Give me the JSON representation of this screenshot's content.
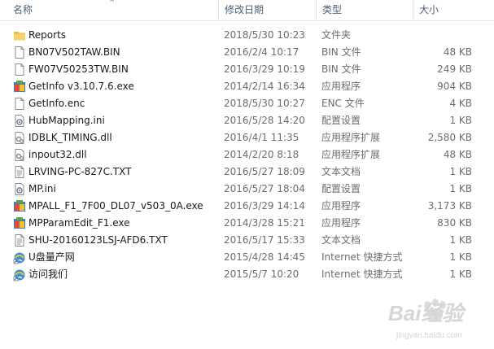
{
  "header": {
    "name": "名称",
    "date": "修改日期",
    "type": "类型",
    "size": "大小"
  },
  "files": [
    {
      "name": "Reports",
      "date": "2018/5/30 10:23",
      "type": "文件夹",
      "size": "",
      "icon": "folder-icon"
    },
    {
      "name": "BN07V502TAW.BIN",
      "date": "2016/2/4 10:17",
      "type": "BIN 文件",
      "size": "48 KB",
      "icon": "file-icon"
    },
    {
      "name": "FW07V50253TW.BIN",
      "date": "2016/3/29 10:19",
      "type": "BIN 文件",
      "size": "249 KB",
      "icon": "file-icon"
    },
    {
      "name": "GetInfo v3.10.7.6.exe",
      "date": "2014/2/14 16:34",
      "type": "应用程序",
      "size": "904 KB",
      "icon": "exe-icon"
    },
    {
      "name": "GetInfo.enc",
      "date": "2018/5/30 10:27",
      "type": "ENC 文件",
      "size": "4 KB",
      "icon": "file-icon"
    },
    {
      "name": "HubMapping.ini",
      "date": "2016/5/28 14:20",
      "type": "配置设置",
      "size": "1 KB",
      "icon": "ini-icon"
    },
    {
      "name": "IDBLK_TIMING.dll",
      "date": "2016/4/1 11:35",
      "type": "应用程序扩展",
      "size": "2,580 KB",
      "icon": "dll-icon"
    },
    {
      "name": "inpout32.dll",
      "date": "2014/2/20 8:18",
      "type": "应用程序扩展",
      "size": "48 KB",
      "icon": "dll-icon"
    },
    {
      "name": "LRVING-PC-827C.TXT",
      "date": "2016/5/27 18:09",
      "type": "文本文档",
      "size": "1 KB",
      "icon": "text-file-icon"
    },
    {
      "name": "MP.ini",
      "date": "2016/5/27 18:04",
      "type": "配置设置",
      "size": "1 KB",
      "icon": "ini-icon"
    },
    {
      "name": "MPALL_F1_7F00_DL07_v503_0A.exe",
      "date": "2016/3/29 14:14",
      "type": "应用程序",
      "size": "3,173 KB",
      "icon": "exe-icon"
    },
    {
      "name": "MPParamEdit_F1.exe",
      "date": "2014/3/28 15:21",
      "type": "应用程序",
      "size": "830 KB",
      "icon": "exe-icon"
    },
    {
      "name": "SHU-20160123LSJ-AFD6.TXT",
      "date": "2016/5/17 15:33",
      "type": "文本文档",
      "size": "1 KB",
      "icon": "text-file-icon"
    },
    {
      "name": "U盘量产网",
      "date": "2015/4/28 14:45",
      "type": "Internet 快捷方式",
      "size": "1 KB",
      "icon": "internet-shortcut-icon"
    },
    {
      "name": "访问我们",
      "date": "2015/5/7 10:20",
      "type": "Internet 快捷方式",
      "size": "1 KB",
      "icon": "internet-shortcut-icon"
    }
  ],
  "watermark": {
    "main": "Bai经验",
    "sub": "jingyan.baidu.com"
  }
}
